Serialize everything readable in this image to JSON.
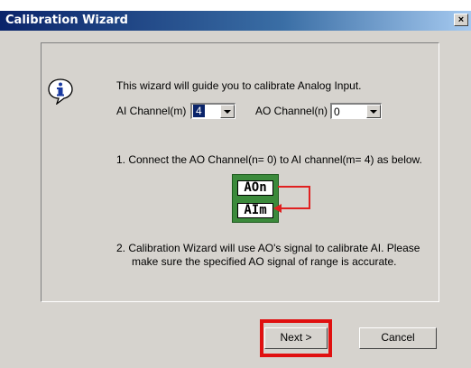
{
  "window": {
    "title": "Calibration Wizard",
    "close_glyph": "×"
  },
  "intro": {
    "text": "This wizard will guide you to calibrate Analog Input."
  },
  "ai_channel": {
    "label": "AI Channel(m)",
    "value": "4"
  },
  "ao_channel": {
    "label": "AO Channel(n)",
    "value": "0"
  },
  "step1": {
    "text": "1.  Connect the AO Channel(n= 0) to AI channel(m= 4) as below."
  },
  "diagram": {
    "ao_label": "AOn",
    "ai_label": "AIm",
    "wire_color": "#e02020",
    "board_color": "#3b8a3b"
  },
  "step2": {
    "line1": "2.  Calibration Wizard will use AO's signal to calibrate AI. Please",
    "line2": "make sure the specified AO signal of  range is accurate."
  },
  "buttons": {
    "next": "Next >",
    "cancel": "Cancel"
  },
  "icons": {
    "info": "info-icon",
    "dropdown": "chevron-down-icon",
    "close": "close-icon"
  },
  "colors": {
    "highlight": "#e01010",
    "titlebar": "#0a246a"
  }
}
